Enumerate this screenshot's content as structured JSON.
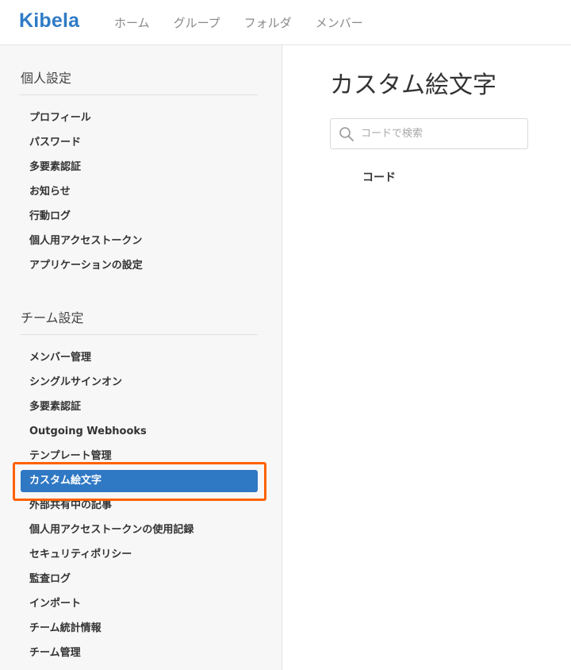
{
  "app": {
    "logo": "Kibela"
  },
  "nav": {
    "items": [
      "ホーム",
      "グループ",
      "フォルダ",
      "メンバー"
    ]
  },
  "sidebar": {
    "personal": {
      "title": "個人設定",
      "items": [
        "プロフィール",
        "パスワード",
        "多要素認証",
        "お知らせ",
        "行動ログ",
        "個人用アクセストークン",
        "アプリケーションの設定"
      ]
    },
    "team": {
      "title": "チーム設定",
      "items": [
        "メンバー管理",
        "シングルサインオン",
        "多要素認証",
        "Outgoing Webhooks",
        "テンプレート管理",
        "カスタム絵文字",
        "外部共有中の記事",
        "個人用アクセストークンの使用記録",
        "セキュリティポリシー",
        "監査ログ",
        "インポート",
        "チーム統計情報",
        "チーム管理"
      ],
      "active": "カスタム絵文字"
    }
  },
  "main": {
    "title": "カスタム絵文字",
    "search": {
      "placeholder": "コードで検索",
      "value": ""
    },
    "column_header": "コード"
  },
  "colors": {
    "brand": "#2f7bc6",
    "active_bg": "#2f78c4",
    "highlight": "#ff6100"
  }
}
